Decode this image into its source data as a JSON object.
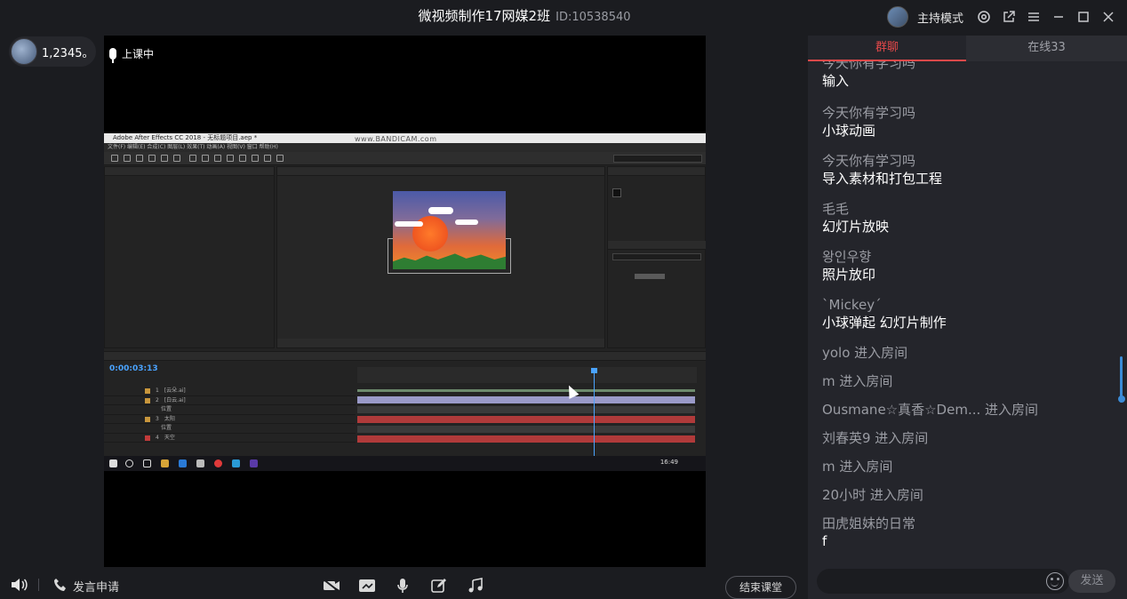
{
  "window": {
    "title": "微视频制作17网媒2班",
    "room_id": "ID:10538540",
    "mode_label": "主持模式"
  },
  "user_badge": {
    "count": "1,2345。"
  },
  "video": {
    "status": "上课中"
  },
  "shared_screen": {
    "app_title": "Adobe After Effects CC 2018 - 无标题项目.aep *",
    "watermark": "www.BANDICAM.com",
    "menu": "文件(F)  编辑(E)  合成(C)  图层(L)  效果(T)  动画(A)  视图(V)  窗口  帮助(H)",
    "timecode": "0:00:03:13",
    "layers": [
      {
        "num": "1",
        "name": "[云朵.ai]",
        "color": "#c8963c"
      },
      {
        "num": "2",
        "name": "[白云.ai]",
        "color": "#c8963c"
      },
      {
        "num": "",
        "name": "位置",
        "color": ""
      },
      {
        "num": "3",
        "name": "太阳",
        "color": "#c8963c"
      },
      {
        "num": "",
        "name": "位置",
        "color": ""
      },
      {
        "num": "4",
        "name": "天空",
        "color": "#c23a3a"
      }
    ],
    "clock": "16:49"
  },
  "bottom_bar": {
    "request_label": "发言申请",
    "end_button": "结束课堂"
  },
  "chat": {
    "tabs": [
      {
        "label": "群聊"
      },
      {
        "label": "在线33"
      }
    ],
    "messages": [
      {
        "name": "今天你有学习吗",
        "text": "输入"
      },
      {
        "name": "今天你有学习吗",
        "text": "小球动画"
      },
      {
        "name": "今天你有学习吗",
        "text": "导入素材和打包工程"
      },
      {
        "name": "毛毛",
        "text": "幻灯片放映"
      },
      {
        "name": "왕인우향",
        "text": "照片放印"
      },
      {
        "name": "`Mickey´",
        "text": "小球弹起  幻灯片制作"
      }
    ],
    "joins": [
      "yolo 进入房间",
      "m 进入房间",
      "Ousmane☆真香☆Dem... 进入房间",
      "刘春英9 进入房间",
      "m 进入房间",
      "20小时 进入房间"
    ],
    "last_message": {
      "name": "田虎姐妹的日常",
      "text": "f"
    },
    "send_label": "发送"
  },
  "colors": {
    "accent": "#e5494a",
    "scroll": "#3b8bd6",
    "timecode": "#4aa3ff"
  }
}
